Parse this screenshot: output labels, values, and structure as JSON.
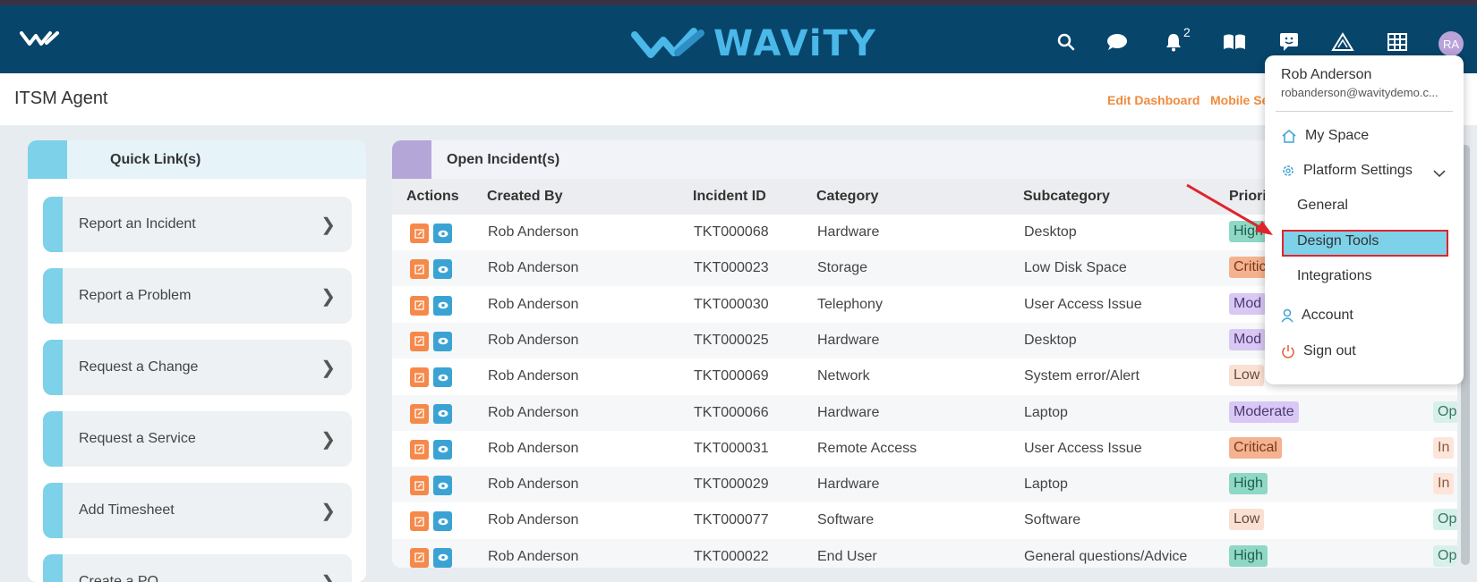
{
  "navbar": {
    "brand": "WAViTY",
    "notification_count": "2",
    "avatar_initials": "RA",
    "icons": [
      "search-icon",
      "chat-icon",
      "bell-icon",
      "book-icon",
      "feedback-icon",
      "warning-icon",
      "grid-icon"
    ]
  },
  "page": {
    "title": "ITSM Agent",
    "edit_dashboard": "Edit Dashboard",
    "mobile_settings": "Mobile Se"
  },
  "quick_links": {
    "title": "Quick Link(s)",
    "items": [
      {
        "label": "Report an Incident"
      },
      {
        "label": "Report a Problem"
      },
      {
        "label": "Request a Change"
      },
      {
        "label": "Request a Service"
      },
      {
        "label": "Add Timesheet"
      },
      {
        "label": "Create a PO"
      }
    ]
  },
  "incidents": {
    "title": "Open Incident(s)",
    "columns": [
      "Actions",
      "Created By",
      "Incident ID",
      "Category",
      "Subcategory",
      "Priori"
    ],
    "rows": [
      {
        "created_by": "Rob Anderson",
        "id": "TKT000068",
        "category": "Hardware",
        "subcategory": "Desktop",
        "priority": "High",
        "status": ""
      },
      {
        "created_by": "Rob Anderson",
        "id": "TKT000023",
        "category": "Storage",
        "subcategory": "Low Disk Space",
        "priority": "Critic",
        "status": ""
      },
      {
        "created_by": "Rob Anderson",
        "id": "TKT000030",
        "category": "Telephony",
        "subcategory": "User Access Issue",
        "priority": "Mod",
        "status": ""
      },
      {
        "created_by": "Rob Anderson",
        "id": "TKT000025",
        "category": "Hardware",
        "subcategory": "Desktop",
        "priority": "Mod",
        "status": ""
      },
      {
        "created_by": "Rob Anderson",
        "id": "TKT000069",
        "category": "Network",
        "subcategory": "System error/Alert",
        "priority": "Low",
        "status": ""
      },
      {
        "created_by": "Rob Anderson",
        "id": "TKT000066",
        "category": "Hardware",
        "subcategory": "Laptop",
        "priority": "Moderate",
        "status": "Op"
      },
      {
        "created_by": "Rob Anderson",
        "id": "TKT000031",
        "category": "Remote Access",
        "subcategory": "User Access Issue",
        "priority": "Critical",
        "status": "In"
      },
      {
        "created_by": "Rob Anderson",
        "id": "TKT000029",
        "category": "Hardware",
        "subcategory": "Laptop",
        "priority": "High",
        "status": "In"
      },
      {
        "created_by": "Rob Anderson",
        "id": "TKT000077",
        "category": "Software",
        "subcategory": "Software",
        "priority": "Low",
        "status": "Op"
      },
      {
        "created_by": "Rob Anderson",
        "id": "TKT000022",
        "category": "End User",
        "subcategory": "General questions/Advice",
        "priority": "High",
        "status": "Op"
      }
    ]
  },
  "user_menu": {
    "name": "Rob Anderson",
    "email": "robanderson@wavitydemo.c...",
    "my_space": "My Space",
    "platform_settings": "Platform Settings",
    "general": "General",
    "design_tools": "Design Tools",
    "integrations": "Integrations",
    "account": "Account",
    "sign_out": "Sign out"
  },
  "colors": {
    "navbar": "#07456b",
    "accent_orange": "#f18a3c",
    "highlight": "#7dd1e9",
    "annotation_red": "#e0242c"
  }
}
